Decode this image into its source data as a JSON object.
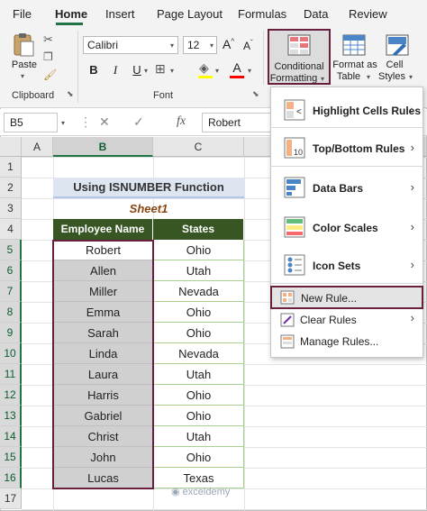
{
  "ribbon": {
    "tabs": [
      "File",
      "Home",
      "Insert",
      "Page Layout",
      "Formulas",
      "Data",
      "Review"
    ],
    "paste_label": "Paste",
    "clipboard_label": "Clipboard",
    "font_name": "Calibri",
    "font_size": "12",
    "font_label": "Font",
    "bold": "B",
    "italic": "I",
    "underline": "U",
    "grow_font": "A",
    "shrink_font": "A",
    "font_color": "A",
    "cf_label_1": "Conditional",
    "cf_label_2": "Formatting",
    "fat_label_1": "Format as",
    "fat_label_2": "Table",
    "cs_label_1": "Cell",
    "cs_label_2": "Styles"
  },
  "formula_bar": {
    "name_box": "B5",
    "fx": "fx",
    "value": "Robert"
  },
  "grid": {
    "columns": [
      "A",
      "B",
      "C"
    ],
    "rows": [
      "1",
      "2",
      "3",
      "4",
      "5",
      "6",
      "7",
      "8",
      "9",
      "10",
      "11",
      "12",
      "13",
      "14",
      "15",
      "16",
      "17"
    ],
    "title": "Using ISNUMBER Function",
    "subtitle": "Sheet1",
    "header_name": "Employee Name",
    "header_states": "States",
    "names": [
      "Robert",
      "Allen",
      "Miller",
      "Emma",
      "Sarah",
      "Linda",
      "Laura",
      "Harris",
      "Gabriel",
      "Christ",
      "John",
      "Lucas"
    ],
    "states": [
      "Ohio",
      "Utah",
      "Nevada",
      "Ohio",
      "Ohio",
      "Nevada",
      "Utah",
      "Ohio",
      "Ohio",
      "Utah",
      "Ohio",
      "Texas"
    ]
  },
  "menu": {
    "highlight": "Highlight Cells Rules",
    "topbottom": "Top/Bottom Rules",
    "databars": "Data Bars",
    "colorscales": "Color Scales",
    "iconsets": "Icon Sets",
    "newrule": "New Rule...",
    "clearrules": "Clear Rules",
    "managerules": "Manage Rules..."
  },
  "watermark": "exceldemy",
  "colors": {
    "accent": "#217346",
    "highlight_border": "#6b1f3f",
    "header_fill": "#375623"
  }
}
